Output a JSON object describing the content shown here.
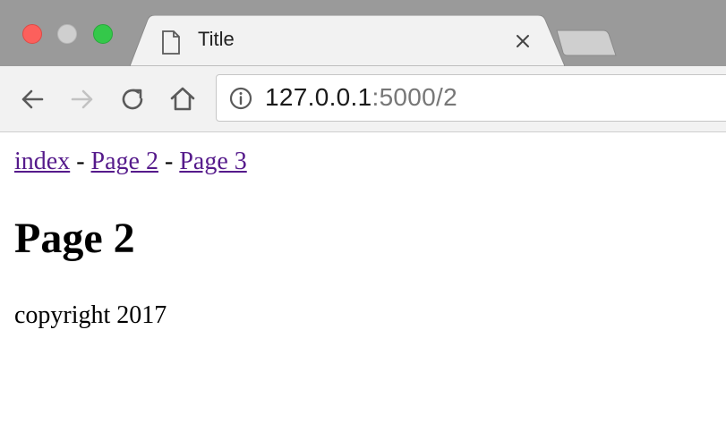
{
  "window": {
    "traffic_lights": [
      "close",
      "minimize",
      "maximize"
    ],
    "colors": {
      "close": "#fc605c",
      "minimize": "#cfcfcf",
      "maximize": "#34c84a"
    }
  },
  "tab": {
    "title": "Title",
    "icon": "document-icon",
    "close_icon": "close-icon"
  },
  "toolbar": {
    "back_icon": "arrow-left-icon",
    "forward_icon": "arrow-right-icon",
    "reload_icon": "reload-icon",
    "home_icon": "home-icon",
    "info_icon": "info-icon",
    "url_host": "127.0.0.1",
    "url_rest": ":5000/2"
  },
  "page": {
    "nav_links": [
      {
        "label": "index"
      },
      {
        "label": "Page 2"
      },
      {
        "label": "Page 3"
      }
    ],
    "separator": "-",
    "heading": "Page 2",
    "footer": "copyright 2017",
    "link_color": "#551a8b"
  }
}
